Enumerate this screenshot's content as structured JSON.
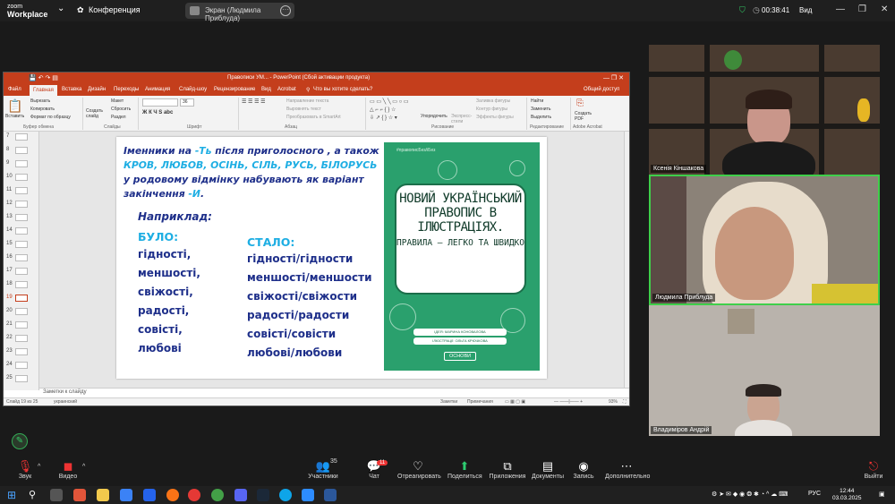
{
  "zoom": {
    "logo_line1": "zoom",
    "logo_line2": "Workplace",
    "meeting_label": "Конференция",
    "share_title": "Экран (Людмила Приблуда)",
    "timer": "00:38:41",
    "view_label": "Вид"
  },
  "ppt": {
    "window_title": "Правописи УМ... - PowerPoint (Сбой активации продукта)",
    "tabs": [
      "Файл",
      "Главная",
      "Вставка",
      "Дизайн",
      "Переходы",
      "Анимация",
      "Слайд-шоу",
      "Рецензирование",
      "Вид",
      "Acrobat"
    ],
    "search_placeholder": "Что вы хотите сделать?",
    "share_label": "Общий доступ",
    "ribbon": {
      "paste": "Вставить",
      "cut": "Вырезать",
      "copy": "Копировать",
      "format_painter": "Формат по образцу",
      "clipboard_group": "Буфер обмена",
      "new_slide": "Создать слайд",
      "layout": "Макет",
      "reset": "Сбросить",
      "sections": "Раздел",
      "slides_group": "Слайды",
      "font_group": "Шрифт",
      "text_direction": "Направление текста",
      "align_text": "Выровнять текст",
      "smartart": "Преобразовать в SmartArt",
      "paragraph_group": "Абзац",
      "arrange": "Упорядочить",
      "quick_styles": "Экспресс-стили",
      "shape_fill": "Заливка фигуры",
      "shape_outline": "Контур фигуры",
      "shape_effects": "Эффекты фигуры",
      "drawing_group": "Рисование",
      "find": "Найти",
      "replace": "Заменить",
      "select": "Выделить",
      "editing_group": "Редактирование",
      "create_pdf": "Создать PDF",
      "acrobat_group": "Adobe Acrobat",
      "font_size": "36"
    },
    "thumb_numbers": [
      "7",
      "8",
      "9",
      "10",
      "11",
      "12",
      "13",
      "14",
      "15",
      "16",
      "17",
      "18",
      "19",
      "20",
      "21",
      "22",
      "23",
      "24",
      "25"
    ],
    "active_slide": "19",
    "notes_placeholder": "Заметки к слайду",
    "status_slide": "Слайд 19 из 25",
    "status_lang": "украинский",
    "status_notes": "Заметки",
    "status_comments": "Примечания",
    "status_zoom": "93%"
  },
  "slide": {
    "intro_part1": "Іменники на ",
    "intro_ending": "-Ть",
    "intro_part2": " після приголосного , а також ",
    "intro_words": "КРОВ, ЛЮБОВ, ОСІНЬ, СІЛЬ, РУСЬ, БІЛОРУСЬ",
    "intro_part3": " у родовому відмінку набувають як варіант закінчення ",
    "intro_variant": "-И",
    "intro_end": ".",
    "example_label": "Наприклад:",
    "before_label": "БУЛО:",
    "after_label": "СТАЛО:",
    "before": [
      "гідності,",
      "меншості,",
      "свіжості,",
      "радості,",
      "совісті,",
      "любові"
    ],
    "after": [
      "гідності/гідности",
      "меншості/меншости",
      "свіжості/свіжости",
      "радості/радости",
      "совісті/совісти",
      "любові/любови"
    ],
    "book": {
      "top_text": "#правописБез/іБез",
      "title": "НОВИЙ УКРАЇНСЬКИЙ ПРАВОПИС В ІЛЮСТРАЦІЯХ.",
      "subtitle": "ПРАВИЛА — ЛЕГКО ТА ШВИДКО",
      "credit1": "ІДЕЯ: МАРИНА КОНОВАЛОВА",
      "credit2": "ІЛЮСТРАЦІЇ: ОЛЬГА КРЮЧКОВА",
      "publisher": "ОСНОВИ",
      "cover_color": "#2aa06d"
    }
  },
  "participants": [
    {
      "name": "Ксенія Кіншакова"
    },
    {
      "name": "Людмила Приблуда"
    },
    {
      "name": "Владиміров Андрій"
    }
  ],
  "toolbar": {
    "mute": "Звук",
    "video": "Видео",
    "participants": "Участники",
    "participants_count": "35",
    "chat": "Чат",
    "chat_badge": "11",
    "react": "Отреагировать",
    "share": "Поделиться",
    "apps": "Приложения",
    "docs": "Документы",
    "record": "Запись",
    "more": "Дополнительно",
    "leave": "Выйти"
  },
  "taskbar": {
    "time": "12:44",
    "date": "03.03.2025",
    "lang": "РУС"
  },
  "colors": {
    "ppt_accent": "#c43e1c",
    "slide_dark_text": "#1e2f8a",
    "slide_highlight": "#1eaee3",
    "active_speaker_border": "#3fcf4a"
  }
}
